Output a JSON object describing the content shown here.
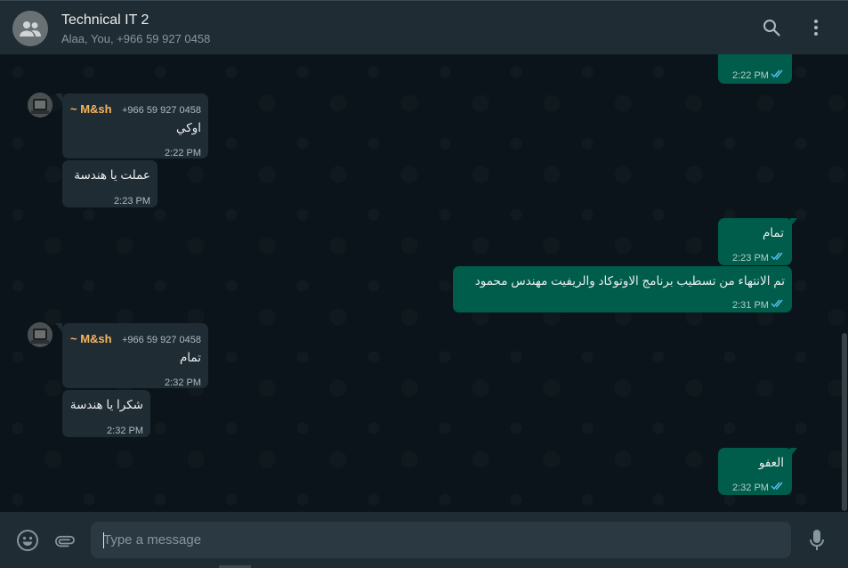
{
  "header": {
    "title": "Technical IT 2",
    "subtitle": "Alaa, You, +966 59 927 0458",
    "search_icon": "search-icon",
    "menu_icon": "kebab-menu-icon"
  },
  "messages": [
    {
      "id": "m0",
      "dir": "out",
      "text": "؟",
      "time": "2:22 PM"
    },
    {
      "id": "m1",
      "dir": "in",
      "sender": "~ M&sh",
      "phone": "+966 59 927 0458",
      "text": "اوكي",
      "time": "2:22 PM"
    },
    {
      "id": "m2",
      "dir": "in",
      "text": "عملت يا هندسة",
      "time": "2:23 PM"
    },
    {
      "id": "m3",
      "dir": "out",
      "text": "تمام",
      "time": "2:23 PM"
    },
    {
      "id": "m4",
      "dir": "out",
      "text": "تم الانتهاء من تسطيب برنامج الاوتوكاد والريفيت مهندس محمود",
      "time": "2:31 PM"
    },
    {
      "id": "m5",
      "dir": "in",
      "sender": "~ M&sh",
      "phone": "+966 59 927 0458",
      "text": "تمام",
      "time": "2:32 PM"
    },
    {
      "id": "m6",
      "dir": "in",
      "text": "شكرا يا هندسة",
      "time": "2:32 PM"
    },
    {
      "id": "m7",
      "dir": "out",
      "text": "العفو",
      "time": "2:32 PM"
    }
  ],
  "footer": {
    "input_placeholder": "Type a message",
    "emoji_icon": "emoji-icon",
    "attach_icon": "paperclip-icon",
    "mic_icon": "microphone-icon"
  },
  "colors": {
    "incoming_bubble": "#202c33",
    "outgoing_bubble": "#005c4b",
    "sender_name": "#f5b461",
    "read_ticks": "#53bdeb"
  }
}
